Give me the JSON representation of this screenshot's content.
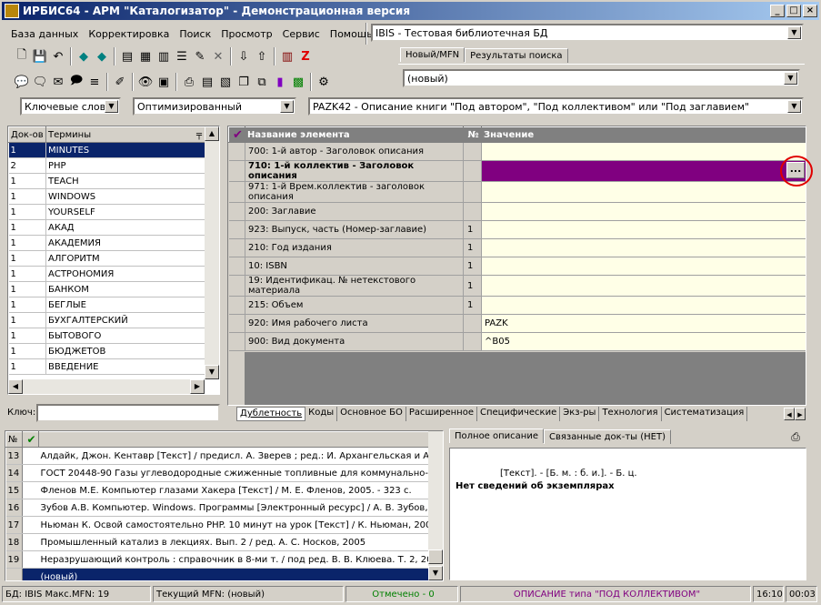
{
  "window": {
    "title": "ИРБИС64 - АРМ \"Каталогизатор\" - Демонстрационная версия"
  },
  "menu": [
    "База данных",
    "Корректировка",
    "Поиск",
    "Просмотр",
    "Сервис",
    "Помощь"
  ],
  "db_selector": {
    "value": "IBIS - Тестовая библиотечная БД"
  },
  "top_tabs": [
    "Новый/MFN",
    "Результаты поиска"
  ],
  "record_selector": {
    "value": "(новый)"
  },
  "search_mode": {
    "value": "Ключевые слова"
  },
  "optimization": {
    "value": "Оптимизированный"
  },
  "worksheet": {
    "value": "PAZK42 - Описание книги \"Под автором\", \"Под коллективом\" или \"Под заглавием\""
  },
  "dictionary": {
    "headers": {
      "count": "Док-ов",
      "term": "Термины"
    },
    "rows": [
      {
        "count": "1",
        "term": "MINUTES"
      },
      {
        "count": "2",
        "term": "PHP"
      },
      {
        "count": "1",
        "term": "TEACH"
      },
      {
        "count": "1",
        "term": "WINDOWS"
      },
      {
        "count": "1",
        "term": "YOURSELF"
      },
      {
        "count": "1",
        "term": "АКАД"
      },
      {
        "count": "1",
        "term": "АКАДЕМИЯ"
      },
      {
        "count": "1",
        "term": "АЛГОРИТМ"
      },
      {
        "count": "1",
        "term": "АСТРОНОМИЯ"
      },
      {
        "count": "1",
        "term": "БАНКОМ"
      },
      {
        "count": "1",
        "term": "БЕГЛЫЕ"
      },
      {
        "count": "1",
        "term": "БУХГАЛТЕРСКИЙ"
      },
      {
        "count": "1",
        "term": "БЫТОВОГО"
      },
      {
        "count": "1",
        "term": "БЮДЖЕТОВ"
      },
      {
        "count": "1",
        "term": "ВВЕДЕНИЕ"
      }
    ],
    "key_label": "Ключ:"
  },
  "editor": {
    "headers": {
      "check": "✔",
      "name": "Название элемента",
      "num": "№",
      "value": "Значение"
    },
    "rows": [
      {
        "name": "700: 1-й автор - Заголовок описания",
        "num": "",
        "value": ""
      },
      {
        "name": "710: 1-й коллектив - Заголовок описания",
        "num": "",
        "value": ""
      },
      {
        "name": "971: 1-й Врем.коллектив - заголовок описания",
        "num": "",
        "value": ""
      },
      {
        "name": "200: Заглавие",
        "num": "",
        "value": ""
      },
      {
        "name": "923: Выпуск, часть (Номер-заглавие)",
        "num": "1",
        "value": ""
      },
      {
        "name": "210: Год издания",
        "num": "1",
        "value": ""
      },
      {
        "name": "10: ISBN",
        "num": "1",
        "value": ""
      },
      {
        "name": "19: Идентификац. № нетекстового материала",
        "num": "1",
        "value": ""
      },
      {
        "name": "215: Объем",
        "num": "1",
        "value": ""
      },
      {
        "name": "920: Имя рабочего листа",
        "num": "",
        "value": "PAZK"
      },
      {
        "name": "900: Вид документа",
        "num": "",
        "value": "^B05"
      }
    ],
    "ellipsis": "...",
    "tabs": [
      "Дублетность",
      "Коды",
      "Основное БО",
      "Расширенное",
      "Специфические",
      "Экз-ры",
      "Технология",
      "Систематизация"
    ]
  },
  "records": {
    "headers": {
      "num": "№",
      "check": "✔"
    },
    "rows": [
      {
        "num": "13",
        "text": "Алдайк, Джон. Кентавр [Текст] / предисл. А. Зверев ; ред.: И. Архангельская и А. К"
      },
      {
        "num": "14",
        "text": "ГОСТ 20448-90 Газы углеводородные сжиженные топливные для коммунально-быт"
      },
      {
        "num": "15",
        "text": "Фленов М.Е. Компьютер глазами Хакера [Текст] / М. Е. Фленов, 2005. - 323 с."
      },
      {
        "num": "16",
        "text": "Зубов А.В. Компьютер. Windows. Программы [Электронный ресурс] / А. В. Зубов, М"
      },
      {
        "num": "17",
        "text": "Ньюман К. Освой самостоятельно PHP. 10 минут на урок [Текст] / К. Ньюман, 2006."
      },
      {
        "num": "18",
        "text": "Промышленный катализ в лекциях. Вып. 2 / ред. А. С. Носков, 2005"
      },
      {
        "num": "19",
        "text": "Неразрушающий контроль : справочник в 8-ми т. / под ред. В. В. Клюева. Т. 2, 2006."
      },
      {
        "num": "",
        "text": "(новый)"
      }
    ]
  },
  "description": {
    "tabs": [
      "Полное описание",
      "Связанные док-ты (НЕТ)"
    ],
    "line1": "[Текст]. - [Б. м. : б. и.]. - Б. ц.",
    "line2": "Нет сведений об экземплярах"
  },
  "statusbar": {
    "db": "БД: IBIS Макс.MFN: 19",
    "mfn": "Текущий MFN: (новый)",
    "marked": "Отмечено - 0",
    "desc_type": "ОПИСАНИЕ типа \"ПОД КОЛЛЕКТИВОМ\"",
    "time": "16:10",
    "elapsed": "00:03"
  },
  "colors": {
    "selection": "#0a246a",
    "highlight": "#800080",
    "editor_bg": "#ffffe7",
    "marked": "#008000",
    "status_purple": "#800080",
    "annotation": "#e00000"
  }
}
